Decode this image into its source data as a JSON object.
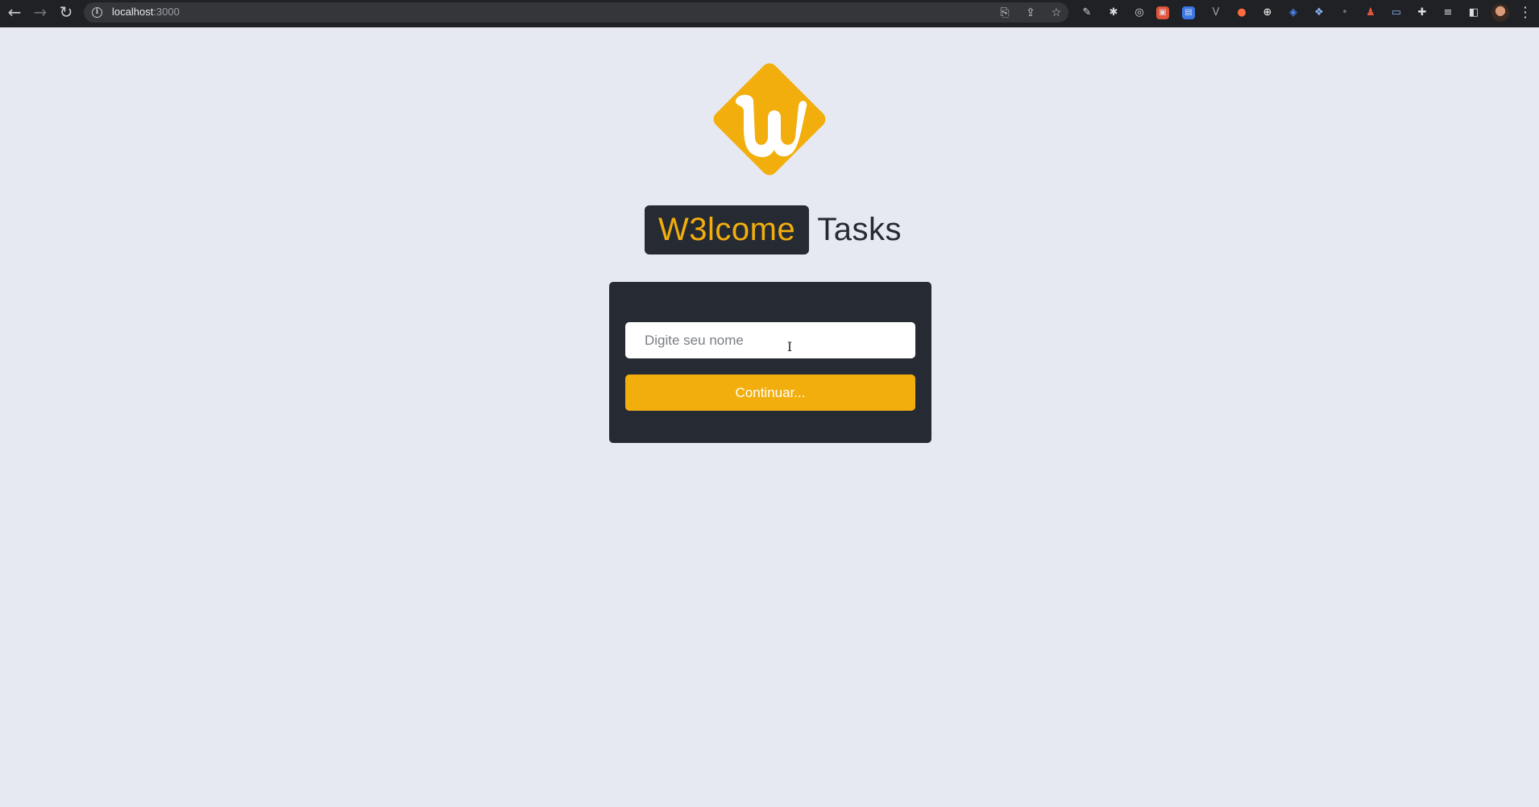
{
  "browser": {
    "back_icon": "←",
    "forward_icon": "→",
    "reload_icon": "↻",
    "url_host": "localhost",
    "url_port": ":3000",
    "extensions": [
      "translate-icon",
      "share-icon",
      "bookmark-star-icon",
      "pen-icon",
      "gear-icon",
      "target-icon",
      "extension-icon",
      "extension-icon",
      "vue-devtools-icon",
      "record-icon",
      "plus-circle-icon",
      "code-icon",
      "paint-icon",
      "dot-icon",
      "extension-icon",
      "window-icon",
      "puzzle-icon",
      "media-icon",
      "sidebar-icon"
    ]
  },
  "logo": {
    "letter": "w",
    "color": "#f2ae0d"
  },
  "brand": {
    "accent_text": "W3lcome",
    "rest_text": "Tasks",
    "accent_color": "#f2ae0d",
    "dark_color": "#262a33"
  },
  "form": {
    "name_placeholder": "Digite seu nome",
    "name_value": "",
    "continue_label": "Continuar..."
  },
  "colors": {
    "background": "#e6e9f1",
    "card": "#262a33",
    "button": "#f2ae0d"
  }
}
